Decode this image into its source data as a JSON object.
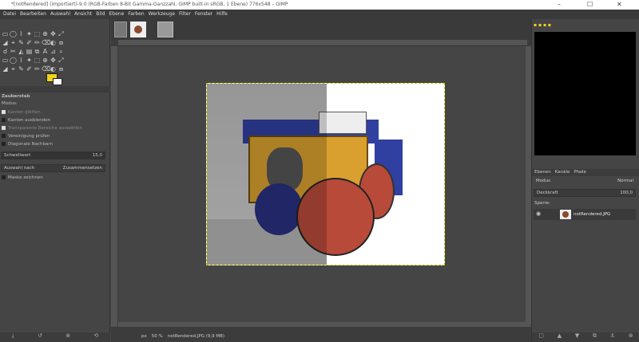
{
  "window": {
    "title": "*[notRendered] (importiert)-9.0 (RGB-Farben 8-Bit Gamma-Ganzzahl, GIMP built-in sRGB, 1 Ebene) 776x548 – GIMP",
    "minimize": "–",
    "maximize": "☐",
    "close": "✕"
  },
  "menu": [
    "Datei",
    "Bearbeiten",
    "Auswahl",
    "Ansicht",
    "Bild",
    "Ebene",
    "Farben",
    "Werkzeuge",
    "Filter",
    "Fenster",
    "Hilfe"
  ],
  "colors": {
    "foreground": "#f3d21a",
    "background": "#ffffff",
    "accent": "#454545"
  },
  "tool_options": {
    "title": "Zauberstab",
    "mode_label": "Modus:",
    "options": [
      "Kanten glätten",
      "Kanten ausblenden",
      "Transparente Bereiche auswählen",
      "Vereinigung prüfen",
      "Diagonale Nachbarn"
    ],
    "threshold_label": "Schwellwert",
    "threshold_value": "15,0",
    "select_by_label": "Auswahl nach",
    "select_by_value": "Zusammensetzen",
    "draw_mask": "Maske zeichnen"
  },
  "status": {
    "unit": "px",
    "zoom": "50 %",
    "file": "notRendered.JPG (9,9 MB)"
  },
  "layers": {
    "tabs": [
      "Ebenen",
      "Kanäle",
      "Pfade"
    ],
    "mode_label": "Modus",
    "mode_value": "Normal",
    "opacity_label": "Deckkraft",
    "opacity_value": "100,0",
    "lock_label": "Sperre:",
    "items": [
      {
        "name": "notRendered.JPG",
        "visible": true
      }
    ]
  }
}
